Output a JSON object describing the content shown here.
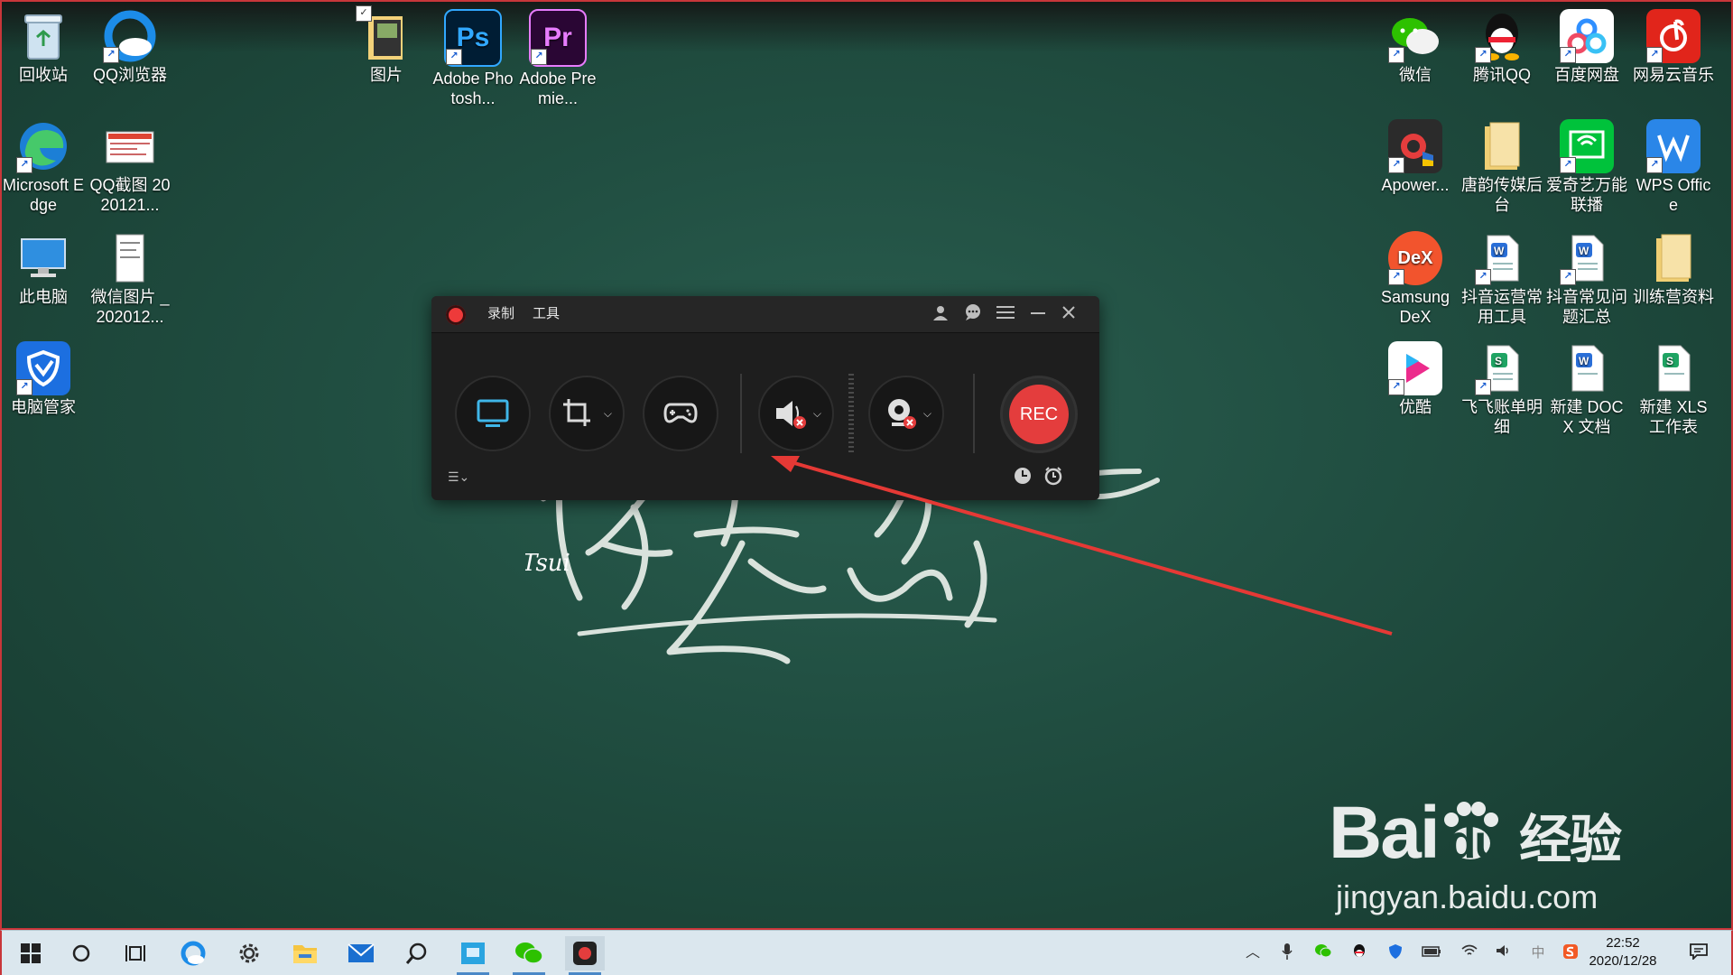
{
  "desktop": {
    "icons_left": [
      {
        "label": "回收站"
      },
      {
        "label": "QQ浏览器"
      },
      {
        "label": "Microsoft Edge"
      },
      {
        "label": "QQ截图 2020121..."
      },
      {
        "label": "此电脑"
      },
      {
        "label": "微信图片 _202012..."
      },
      {
        "label": "电脑管家"
      }
    ],
    "icons_top": [
      {
        "label": "图片"
      },
      {
        "label": "Adobe Photosh...",
        "glyph": "Ps"
      },
      {
        "label": "Adobe Premie...",
        "glyph": "Pr"
      }
    ],
    "icons_right": [
      {
        "label": "微信"
      },
      {
        "label": "腾讯QQ"
      },
      {
        "label": "百度网盘"
      },
      {
        "label": "网易云音乐"
      },
      {
        "label": "Apower..."
      },
      {
        "label": "唐韵传媒后台"
      },
      {
        "label": "爱奇艺万能联播"
      },
      {
        "label": "WPS Office"
      },
      {
        "label": "Samsung DeX",
        "glyph": "DeX"
      },
      {
        "label": "抖音运营常用工具"
      },
      {
        "label": "抖音常见问题汇总"
      },
      {
        "label": "训练营资料"
      },
      {
        "label": "优酷"
      },
      {
        "label": "飞飞账单明细"
      },
      {
        "label": "新建 DOCX 文档"
      },
      {
        "label": "新建 XLS 工作表"
      }
    ],
    "signature": "。Tsui"
  },
  "recorder": {
    "menu_record": "录制",
    "menu_tools": "工具",
    "rec_label": "REC",
    "colors": {
      "accent": "#e43d3d",
      "screen_icon": "#3fb6e8"
    }
  },
  "taskbar": {
    "time": "22:52",
    "date": "2020/12/28",
    "ime": "中"
  },
  "watermark": {
    "brand": "Bai",
    "brand_tail": "du",
    "brand_cn": "经验",
    "url": "jingyan.baidu.com"
  }
}
